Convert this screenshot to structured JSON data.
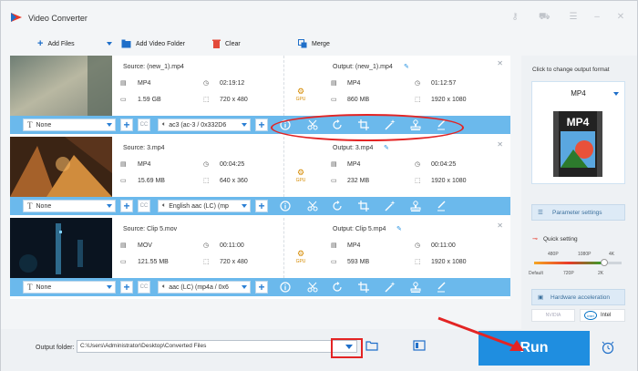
{
  "app": {
    "title": "Video Converter",
    "accent": "#1f8ee0",
    "bar_color": "#6bb9ec"
  },
  "toolbar": {
    "add_files": "Add Files",
    "add_video_folder": "Add Video Folder",
    "clear": "Clear",
    "merge": "Merge"
  },
  "items": [
    {
      "source": "Source: (new_1).mp4",
      "src_format": "MP4",
      "src_duration": "02:19:12",
      "src_size": "1.59 GB",
      "src_res": "720 x 480",
      "output": "Output: (new_1).mp4",
      "out_format": "MP4",
      "out_duration": "01:12:57",
      "out_size": "860 MB",
      "out_res": "1920 x 1080",
      "subtitle": "None",
      "audio": "ac3 (ac-3 / 0x332D6",
      "gpu": "GPU"
    },
    {
      "source": "Source: 3.mp4",
      "src_format": "MP4",
      "src_duration": "00:04:25",
      "src_size": "15.69 MB",
      "src_res": "640 x 360",
      "output": "Output: 3.mp4",
      "out_format": "MP4",
      "out_duration": "00:04:25",
      "out_size": "232 MB",
      "out_res": "1920 x 1080",
      "subtitle": "None",
      "audio": "English aac (LC) (mp",
      "gpu": "GPU"
    },
    {
      "source": "Source: Clip 5.mov",
      "src_format": "MOV",
      "src_duration": "00:11:00",
      "src_size": "121.55 MB",
      "src_res": "720 x 480",
      "output": "Output: Clip 5.mp4",
      "out_format": "MP4",
      "out_duration": "00:11:00",
      "out_size": "593 MB",
      "out_res": "1920 x 1080",
      "subtitle": "None",
      "audio": "aac (LC) (mp4a / 0x6",
      "gpu": "GPU"
    }
  ],
  "panel": {
    "title": "Click to change output format",
    "format": "MP4",
    "format_icon_text": "MP4",
    "param_settings": "Parameter settings",
    "quick_setting": "Quick setting",
    "quality_top": [
      "480P",
      "1080P",
      "4K"
    ],
    "quality_bottom": [
      "Default",
      "720P",
      "2K"
    ],
    "quality_level": 0.8,
    "hw_accel": "Hardware acceleration",
    "nvidia": "NVIDIA",
    "intel_logo": "intel",
    "intel": "Intel"
  },
  "bottom": {
    "output_label": "Output folder:",
    "output_path": "C:\\Users\\Administrator\\Desktop\\Converted Files",
    "run": "Run"
  }
}
